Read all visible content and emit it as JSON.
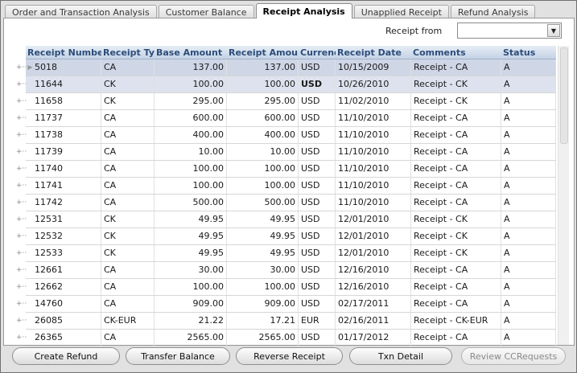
{
  "tabs": [
    {
      "label": "Order and Transaction Analysis",
      "active": false
    },
    {
      "label": "Customer Balance",
      "active": false
    },
    {
      "label": "Receipt Analysis",
      "active": true
    },
    {
      "label": "Unapplied Receipt",
      "active": false
    },
    {
      "label": "Refund Analysis",
      "active": false
    }
  ],
  "filter": {
    "label": "Receipt from",
    "value": ""
  },
  "columns": [
    "Receipt Number",
    "Receipt Ty",
    "Base Amount",
    "Receipt Amoun",
    "Currenc",
    "Receipt Date",
    "Comments",
    "Status"
  ],
  "rows": [
    {
      "receipt_number": "5018",
      "receipt_type": "CA",
      "base_amount": "137.00",
      "receipt_amount": "137.00",
      "currency": "USD",
      "receipt_date": "10/15/2009",
      "comments": "Receipt - CA",
      "status": "A"
    },
    {
      "receipt_number": "11644",
      "receipt_type": "CK",
      "base_amount": "100.00",
      "receipt_amount": "100.00",
      "currency": "USD",
      "receipt_date": "10/26/2010",
      "comments": "Receipt - CK",
      "status": "A"
    },
    {
      "receipt_number": "11658",
      "receipt_type": "CK",
      "base_amount": "295.00",
      "receipt_amount": "295.00",
      "currency": "USD",
      "receipt_date": "11/02/2010",
      "comments": "Receipt - CK",
      "status": "A"
    },
    {
      "receipt_number": "11737",
      "receipt_type": "CA",
      "base_amount": "600.00",
      "receipt_amount": "600.00",
      "currency": "USD",
      "receipt_date": "11/10/2010",
      "comments": "Receipt - CA",
      "status": "A"
    },
    {
      "receipt_number": "11738",
      "receipt_type": "CA",
      "base_amount": "400.00",
      "receipt_amount": "400.00",
      "currency": "USD",
      "receipt_date": "11/10/2010",
      "comments": "Receipt - CA",
      "status": "A"
    },
    {
      "receipt_number": "11739",
      "receipt_type": "CA",
      "base_amount": "10.00",
      "receipt_amount": "10.00",
      "currency": "USD",
      "receipt_date": "11/10/2010",
      "comments": "Receipt - CA",
      "status": "A"
    },
    {
      "receipt_number": "11740",
      "receipt_type": "CA",
      "base_amount": "100.00",
      "receipt_amount": "100.00",
      "currency": "USD",
      "receipt_date": "11/10/2010",
      "comments": "Receipt - CA",
      "status": "A"
    },
    {
      "receipt_number": "11741",
      "receipt_type": "CA",
      "base_amount": "100.00",
      "receipt_amount": "100.00",
      "currency": "USD",
      "receipt_date": "11/10/2010",
      "comments": "Receipt - CA",
      "status": "A"
    },
    {
      "receipt_number": "11742",
      "receipt_type": "CA",
      "base_amount": "500.00",
      "receipt_amount": "500.00",
      "currency": "USD",
      "receipt_date": "11/10/2010",
      "comments": "Receipt - CA",
      "status": "A"
    },
    {
      "receipt_number": "12531",
      "receipt_type": "CK",
      "base_amount": "49.95",
      "receipt_amount": "49.95",
      "currency": "USD",
      "receipt_date": "12/01/2010",
      "comments": "Receipt - CK",
      "status": "A"
    },
    {
      "receipt_number": "12532",
      "receipt_type": "CK",
      "base_amount": "49.95",
      "receipt_amount": "49.95",
      "currency": "USD",
      "receipt_date": "12/01/2010",
      "comments": "Receipt - CK",
      "status": "A"
    },
    {
      "receipt_number": "12533",
      "receipt_type": "CK",
      "base_amount": "49.95",
      "receipt_amount": "49.95",
      "currency": "USD",
      "receipt_date": "12/01/2010",
      "comments": "Receipt - CK",
      "status": "A"
    },
    {
      "receipt_number": "12661",
      "receipt_type": "CA",
      "base_amount": "30.00",
      "receipt_amount": "30.00",
      "currency": "USD",
      "receipt_date": "12/16/2010",
      "comments": "Receipt - CA",
      "status": "A"
    },
    {
      "receipt_number": "12662",
      "receipt_type": "CA",
      "base_amount": "100.00",
      "receipt_amount": "100.00",
      "currency": "USD",
      "receipt_date": "12/16/2010",
      "comments": "Receipt - CA",
      "status": "A"
    },
    {
      "receipt_number": "14760",
      "receipt_type": "CA",
      "base_amount": "909.00",
      "receipt_amount": "909.00",
      "currency": "USD",
      "receipt_date": "02/17/2011",
      "comments": "Receipt - CA",
      "status": "A"
    },
    {
      "receipt_number": "26085",
      "receipt_type": "CK-EUR",
      "base_amount": "21.22",
      "receipt_amount": "17.21",
      "currency": "EUR",
      "receipt_date": "02/16/2011",
      "comments": "Receipt - CK-EUR",
      "status": "A"
    },
    {
      "receipt_number": "26365",
      "receipt_type": "CA",
      "base_amount": "2565.00",
      "receipt_amount": "2565.00",
      "currency": "USD",
      "receipt_date": "01/17/2012",
      "comments": "Receipt - CA",
      "status": "A"
    }
  ],
  "buttons": {
    "create_refund": "Create Refund",
    "transfer_balance": "Transfer Balance",
    "reverse_receipt": "Reverse Receipt",
    "txn_detail": "Txn Detail",
    "review_cc_requests": "Review CCRequests"
  },
  "colors": {
    "header_text": "#2d4d7a",
    "selected_row": "#cfd6e6"
  },
  "icons": {
    "tree_connector": "tree-expander-icon",
    "dropdown": "chevron-down-icon",
    "current_row": "row-pointer-icon"
  }
}
